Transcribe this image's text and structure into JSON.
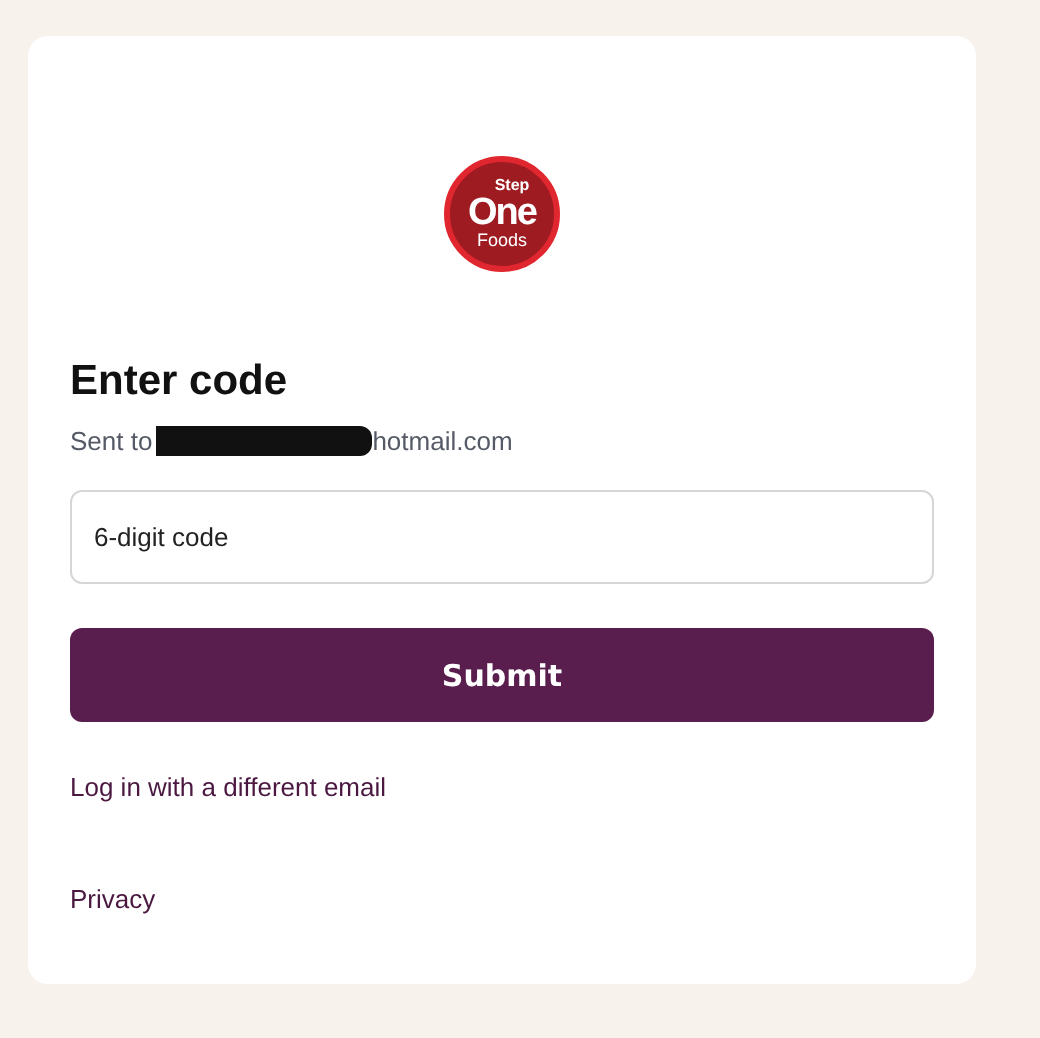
{
  "logo": {
    "top": "Step",
    "middle": "One",
    "bottom": "Foods"
  },
  "heading": "Enter code",
  "sent": {
    "prefix": "Sent to",
    "redacted": true,
    "suffix": "hotmail.com"
  },
  "code_field": {
    "placeholder": "6-digit code"
  },
  "submit": "Submit",
  "alt_link": "Log in with a different email",
  "footer_link": "Privacy"
}
